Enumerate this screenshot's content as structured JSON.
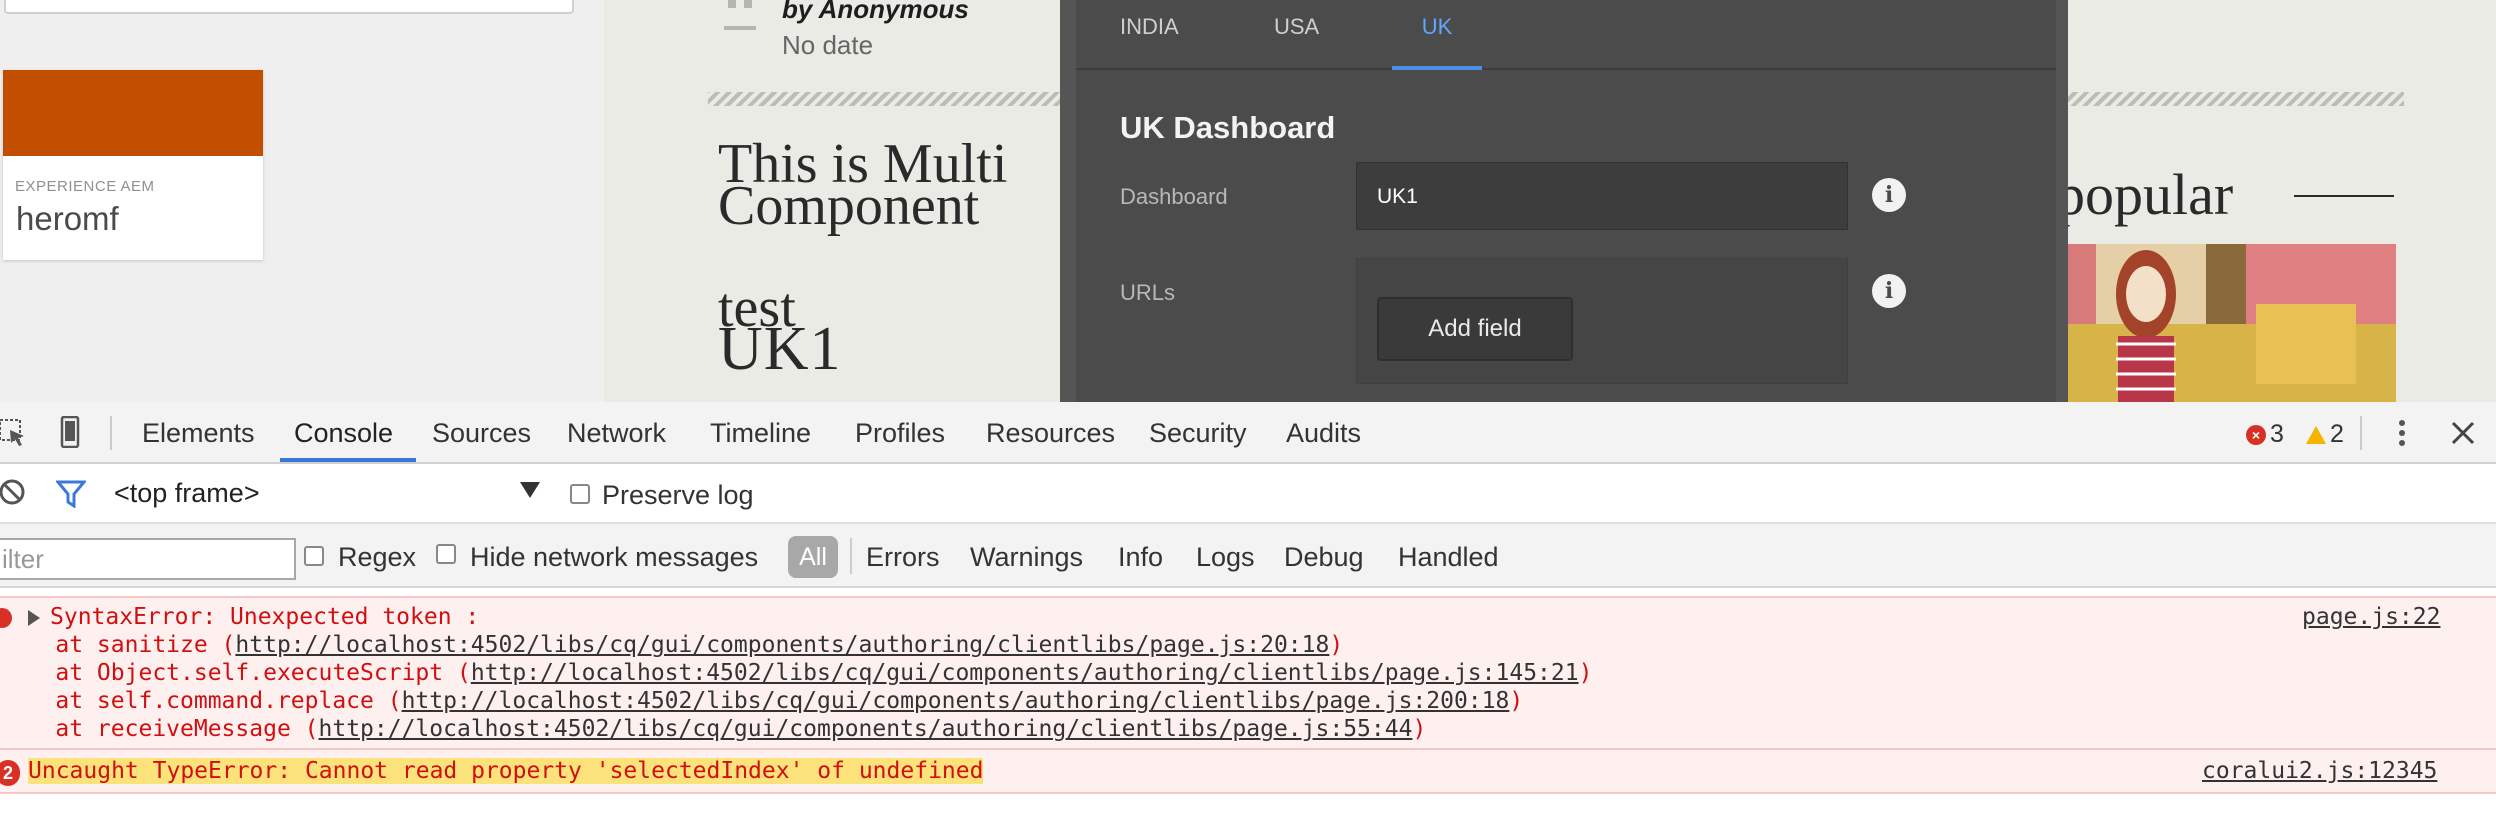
{
  "page": {
    "card": {
      "label": "EXPERIENCE AEM",
      "title": "heromf"
    },
    "content": {
      "byline": "by Anonymous",
      "date": "No date",
      "title_line1": "This is Multi",
      "title_line2": "Component",
      "test": "test",
      "value": "UK1",
      "popular": "popular"
    }
  },
  "dialog": {
    "tabs": [
      {
        "label": "INDIA",
        "active": false
      },
      {
        "label": "USA",
        "active": false
      },
      {
        "label": "UK",
        "active": true
      }
    ],
    "title": "UK Dashboard",
    "dashboard_label": "Dashboard",
    "dashboard_value": "UK1",
    "urls_label": "URLs",
    "add_field_label": "Add field",
    "info_glyph": "i"
  },
  "devtools": {
    "tabs": [
      "Elements",
      "Console",
      "Sources",
      "Network",
      "Timeline",
      "Profiles",
      "Resources",
      "Security",
      "Audits"
    ],
    "active_tab": "Console",
    "error_count": "3",
    "warning_count": "2",
    "frame": "<top frame>",
    "preserve_log": "Preserve log",
    "filter_placeholder": "ilter",
    "regex": "Regex",
    "hide_network": "Hide network messages",
    "levels": [
      "All",
      "Errors",
      "Warnings",
      "Info",
      "Logs",
      "Debug",
      "Handled"
    ],
    "messages": [
      {
        "text": "SyntaxError: Unexpected token :",
        "source": "page.js:22",
        "stack": [
          {
            "prefix": "    at sanitize (",
            "url": "http://localhost:4502/libs/cq/gui/components/authoring/clientlibs/page.js:20:18",
            "suffix": ")"
          },
          {
            "prefix": "    at Object.self.executeScript (",
            "url": "http://localhost:4502/libs/cq/gui/components/authoring/clientlibs/page.js:145:21",
            "suffix": ")"
          },
          {
            "prefix": "    at self.command.replace (",
            "url": "http://localhost:4502/libs/cq/gui/components/authoring/clientlibs/page.js:200:18",
            "suffix": ")"
          },
          {
            "prefix": "    at receiveMessage (",
            "url": "http://localhost:4502/libs/cq/gui/components/authoring/clientlibs/page.js:55:44",
            "suffix": ")"
          }
        ]
      },
      {
        "count": "2",
        "text": "Uncaught TypeError: Cannot read property 'selectedIndex' of undefined",
        "source": "coralui2.js:12345"
      }
    ]
  },
  "colors": {
    "card_banner": "#c24f00",
    "dialog_bg": "#4b4b4b",
    "active_tab": "#5fa6ff",
    "error": "#d01010",
    "error_row_bg": "#fff0f0",
    "highlight": "#fbe27b"
  }
}
